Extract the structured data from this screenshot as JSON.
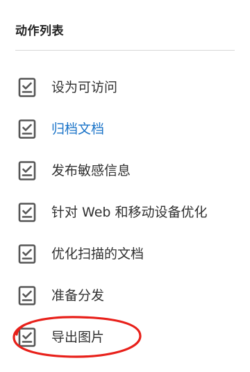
{
  "panel": {
    "title": "动作列表"
  },
  "actions": [
    {
      "label": "设为可访问",
      "icon": "checklist-icon",
      "is_link": false
    },
    {
      "label": "归档文档",
      "icon": "checklist-icon",
      "is_link": true
    },
    {
      "label": "发布敏感信息",
      "icon": "checklist-icon",
      "is_link": false
    },
    {
      "label": "针对 Web 和移动设备优化",
      "icon": "checklist-icon",
      "is_link": false
    },
    {
      "label": "优化扫描的文档",
      "icon": "checklist-icon",
      "is_link": false
    },
    {
      "label": "准备分发",
      "icon": "checklist-icon",
      "is_link": false
    },
    {
      "label": "导出图片",
      "icon": "checklist-icon",
      "is_link": false
    }
  ],
  "colors": {
    "link": "#1a73c8",
    "text": "#303030",
    "icon": "#555555",
    "highlight": "#e8201a"
  }
}
